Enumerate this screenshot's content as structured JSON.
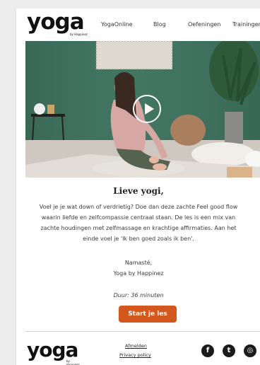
{
  "brand": {
    "logo": "yoga",
    "tagline": "by Happinez"
  },
  "nav": {
    "items": [
      {
        "label": "YogaOnline"
      },
      {
        "label": "Blog"
      },
      {
        "label": "Oefeningen"
      },
      {
        "label": "Trainingen"
      }
    ]
  },
  "hero": {
    "play_icon": "play-icon"
  },
  "content": {
    "greeting": "Lieve yogi,",
    "lines": [
      "Voel je je wat down of verdrietig? Doe dan deze zachte Feel good flow",
      "waarin liefde en zelfcompassie centraal staan. De les is een mix van",
      "zachte houdingen met zelfmassage en krachtige affirmaties. Aan het",
      "einde voel je 'Ik ben goed zoals ik ben'."
    ],
    "sign_off": "Namasté,",
    "signature": "Yoga by Happinez",
    "duration": "Duur: 36 minuten",
    "cta": "Start je les"
  },
  "footer": {
    "unsubscribe": "Afmelden",
    "privacy": "Privacy policy",
    "social": [
      {
        "icon": "facebook-icon",
        "glyph": "f"
      },
      {
        "icon": "twitter-icon",
        "glyph": "t"
      },
      {
        "icon": "instagram-icon",
        "glyph": "◎"
      }
    ]
  },
  "colors": {
    "accent": "#d4571e",
    "hero_wall": "#3f7360"
  }
}
